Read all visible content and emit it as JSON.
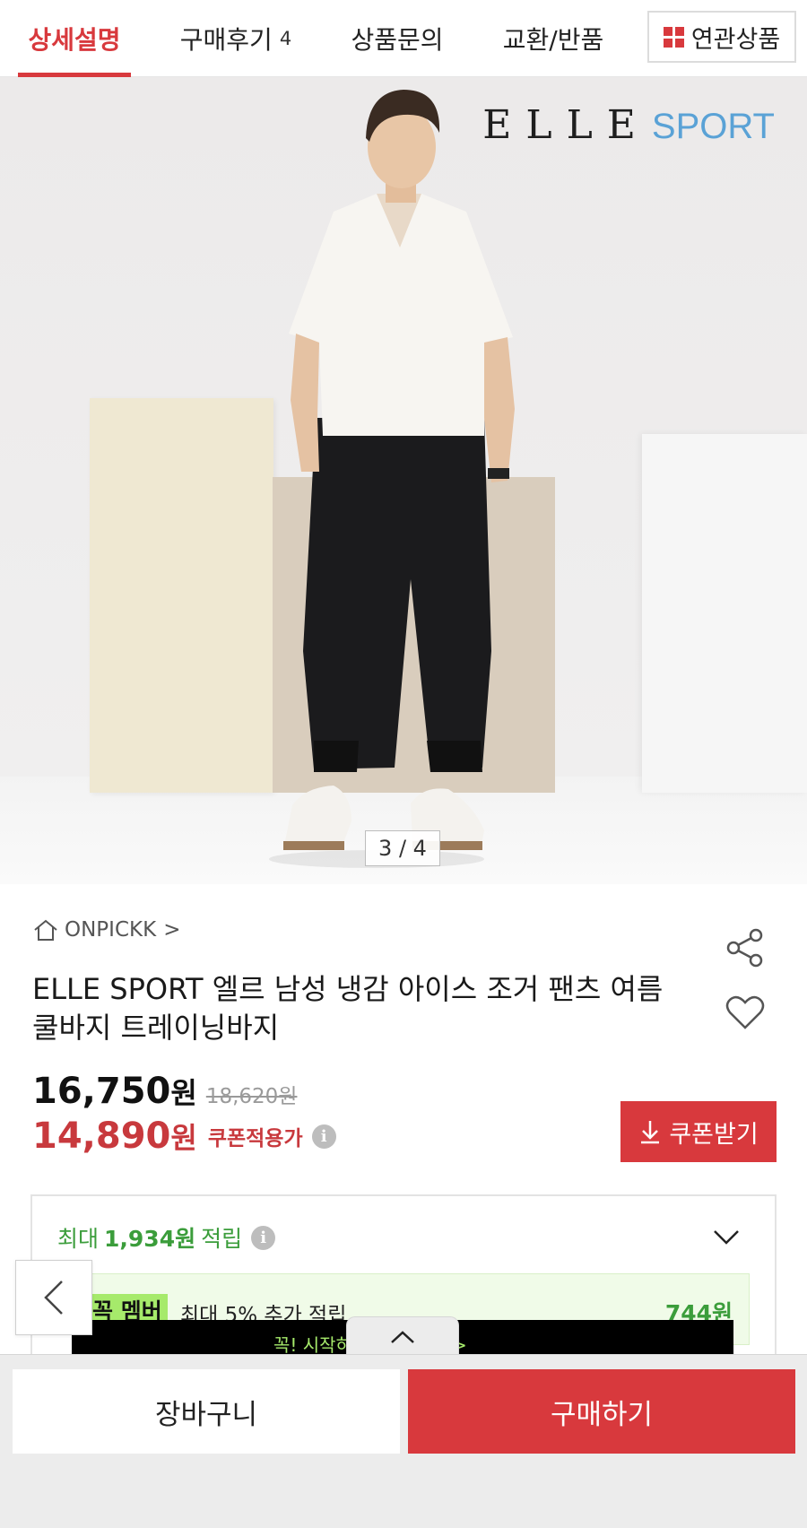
{
  "tabs": [
    {
      "label": "상세설명",
      "count": ""
    },
    {
      "label": "구매후기",
      "count": "4"
    },
    {
      "label": "상품문의",
      "count": ""
    },
    {
      "label": "교환/반품",
      "count": ""
    }
  ],
  "related_label": "연관상품",
  "hero": {
    "brand_elle": "ELLE",
    "brand_sport": "SPORT",
    "page_counter": "3 / 4"
  },
  "product": {
    "store": "ONPICKK",
    "store_chevron": ">",
    "title": "ELLE SPORT 엘르 남성 냉감 아이스 조거 팬츠 여름 쿨바지 트레이닝바지",
    "price": "16,750",
    "price_unit": "원",
    "original_price": "18,620원",
    "coupon_price": "14,890",
    "coupon_unit": "원",
    "coupon_label": "쿠폰적용가",
    "info_glyph": "i",
    "coupon_button": "쿠폰받기"
  },
  "reward": {
    "prefix": "최대",
    "amount": "1,934원",
    "suffix": "적립",
    "member_badge": "꼭 멤버",
    "member_text": "최대 5% 추가 적립",
    "member_amount": "744원",
    "strip_text": "꼭! 시작하고 혜택 받기 >"
  },
  "bottom": {
    "cart": "장바구니",
    "buy": "구매하기"
  },
  "colors": {
    "accent": "#d8393d",
    "reward_green": "#3b9d3b",
    "member_green": "#a6ea6b",
    "sport_blue": "#5aa2d6"
  }
}
